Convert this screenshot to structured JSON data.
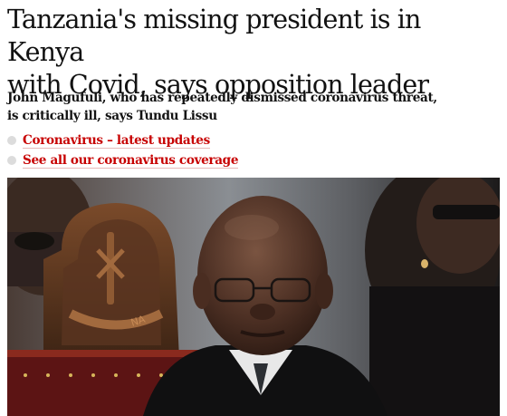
{
  "article": {
    "headline_line1": "Tanzania's missing president is in Kenya",
    "headline_line2": "with Covid, says opposition leader",
    "standfirst_line1": "John Magufuli, who has repeatedly dismissed coronavirus threat,",
    "standfirst_line2": "is critically ill, says Tundu Lissu",
    "related_links": [
      {
        "label": "Coronavirus – latest updates"
      },
      {
        "label": "See all our coronavirus coverage"
      }
    ],
    "photo": {
      "chair_emblem_text": "NA"
    }
  },
  "colors": {
    "headline": "#121212",
    "link": "#c70000",
    "bullet": "#dcdcdc"
  }
}
